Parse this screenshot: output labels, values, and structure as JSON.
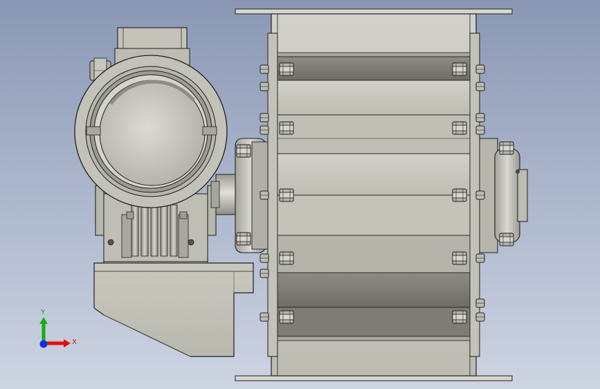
{
  "triad": {
    "y_label": "Y",
    "x_label": "X"
  },
  "colors": {
    "background_top": "#8a97b4",
    "background_bottom": "#cdd4e2",
    "metal_light": "#c9c8bf",
    "metal_mid": "#a6a59e",
    "metal_dark": "#6d6c66",
    "edge": "#1e1e1e",
    "axis_x": "#e01010",
    "axis_y": "#10b010",
    "axis_z": "#1030e0"
  },
  "icons": {
    "triad": "coordinate-triad-icon"
  }
}
